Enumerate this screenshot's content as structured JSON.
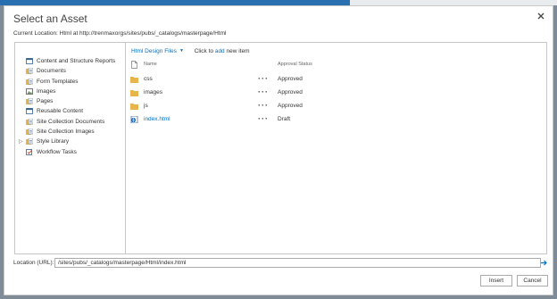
{
  "dialog": {
    "title": "Select an Asset",
    "current_location": "Current Location: Html at http://trenmaxorgs/sites/pubs/_catalogs/masterpage/Html"
  },
  "tree": {
    "items": [
      {
        "label": "Content and Structure Reports",
        "icon": "list-icon"
      },
      {
        "label": "Documents",
        "icon": "document-library-icon"
      },
      {
        "label": "Form Templates",
        "icon": "document-library-icon"
      },
      {
        "label": "Images",
        "icon": "image-library-icon"
      },
      {
        "label": "Pages",
        "icon": "document-library-icon"
      },
      {
        "label": "Reusable Content",
        "icon": "list-icon"
      },
      {
        "label": "Site Collection Documents",
        "icon": "document-library-icon"
      },
      {
        "label": "Site Collection Images",
        "icon": "document-library-icon"
      },
      {
        "label": "Style Library",
        "icon": "document-library-icon",
        "expandable": true
      },
      {
        "label": "Workflow Tasks",
        "icon": "tasks-icon"
      }
    ]
  },
  "toolbar": {
    "view_label": "Html Design Files",
    "hint_prefix": "Click to",
    "hint_link": "add",
    "hint_suffix": "new item"
  },
  "columns": {
    "name": "Name",
    "status": "Approval Status"
  },
  "files": [
    {
      "name": "css",
      "type": "folder",
      "status": "Approved"
    },
    {
      "name": "images",
      "type": "folder",
      "status": "Approved"
    },
    {
      "name": "js",
      "type": "folder",
      "status": "Approved"
    },
    {
      "name": "index.html",
      "type": "html-file",
      "status": "Draft"
    }
  ],
  "location": {
    "label": "Location (URL):",
    "value": "/sites/pubs/_catalogs/masterpage/Html/index.html"
  },
  "buttons": {
    "insert": "Insert",
    "cancel": "Cancel"
  },
  "colors": {
    "accent": "#0072c6",
    "folder": "#e8b44c",
    "top_bar": "#2a6fb0"
  }
}
